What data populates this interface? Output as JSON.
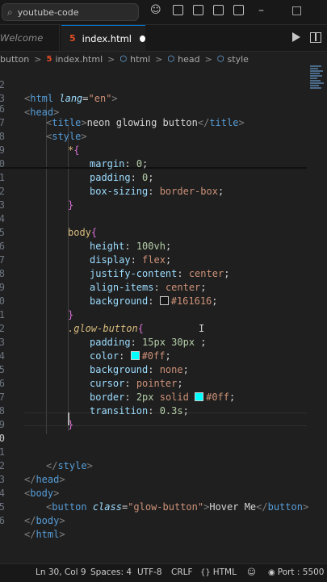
{
  "titlebar": {
    "search_text": "youtube-code",
    "icons": [
      "search-icon",
      "copilot-icon",
      "layout-sidebar-left-icon",
      "layout-panel-icon",
      "layout-sidebar-right-icon",
      "layout-icon",
      "minimize-icon",
      "maximize-icon"
    ]
  },
  "tabs": {
    "welcome": "Welcome",
    "active": "index.html"
  },
  "breadcrumb": {
    "items": [
      "button",
      "index.html",
      "html",
      "head",
      "style"
    ],
    "separator": ">"
  },
  "editor": {
    "line_numbers": [
      "2",
      "3",
      "6",
      "7",
      "8",
      "9",
      "0",
      "1",
      "2",
      "3",
      "4",
      "5",
      "6",
      "7",
      "8",
      "9",
      "0",
      "1",
      "2",
      "3",
      "4",
      "5",
      "6",
      "7",
      "8",
      "9",
      "0",
      "1",
      "2",
      "3",
      "4",
      "5",
      "6"
    ],
    "lines": {
      "l2_html": "html",
      "l2_lang": "lang",
      "l2_eq": "=",
      "l2_val": "\"en\"",
      "l3_head": "head",
      "l6_title_open": "title",
      "l6_text": "neon glowing button",
      "l6_title_close": "title",
      "l7_style": "style",
      "l8_star": "*",
      "l8_brace": "{",
      "l9_prop": "margin",
      "l9_val": "0",
      "l10_prop": "padding",
      "l10_val": "0",
      "l11_prop": "box-sizing",
      "l11_val": "border-box",
      "l12_brace": "}",
      "l14_sel": "body",
      "l14_brace": "{",
      "l15_prop": "height",
      "l15_val": "100vh",
      "l16_prop": "display",
      "l16_val": "flex",
      "l17_prop": "justify-content",
      "l17_val": "center",
      "l18_prop": "align-items",
      "l18_val": "center",
      "l19_prop": "background",
      "l19_val": "#161616",
      "l20_brace": "}",
      "l21_sel": ".glow-button",
      "l21_brace": "{",
      "l22_prop": "padding",
      "l22_val": "15px 30px",
      "l23_prop": "color",
      "l23_val": "#0ff",
      "l24_prop": "background",
      "l24_val": "none",
      "l25_prop": "cursor",
      "l25_val": "pointer",
      "l26_prop": "border",
      "l26_val1": "2px",
      "l26_val2": "solid",
      "l26_val3": "#0ff",
      "l27_prop": "transition",
      "l27_val": "0.3s",
      "l28_brace": "}",
      "l31_style": "style",
      "l32_head": "head",
      "l33_body": "body",
      "l34_button": "button",
      "l34_attr": "class",
      "l34_val": "\"glow-button\"",
      "l34_text": "Hover Me",
      "l34_close": "button",
      "l35_body": "body",
      "l36_html": "html"
    },
    "colors": {
      "swatch_161616": "#161616",
      "swatch_0ff": "#00ffff"
    }
  },
  "statusbar": {
    "position": "Ln 30, Col 9",
    "spaces": "Spaces: 4",
    "encoding": "UTF-8",
    "eol": "CRLF",
    "language": "HTML",
    "port": "Port : 5500"
  }
}
